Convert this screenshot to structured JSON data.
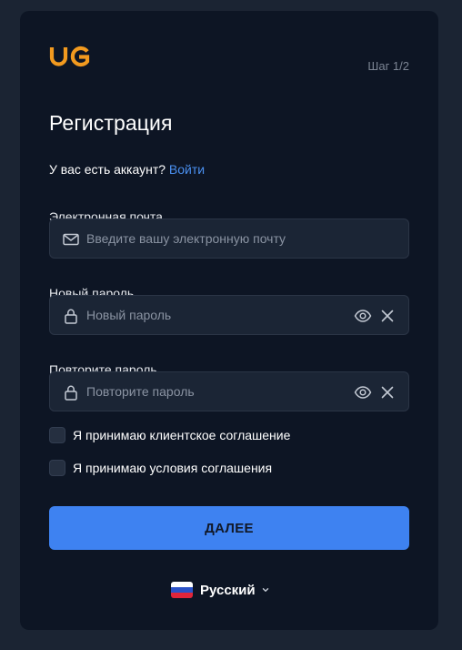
{
  "header": {
    "logo_text": "UG",
    "step": "Шаг 1/2"
  },
  "form": {
    "title": "Регистрация",
    "account_prompt": "У вас есть аккаунт?",
    "login_link": "Войти",
    "email": {
      "label": "Электронная почта",
      "placeholder": "Введите вашу электронную почту",
      "value": ""
    },
    "new_password": {
      "label": "Новый пароль",
      "placeholder": "Новый пароль",
      "value": ""
    },
    "repeat_password": {
      "label": "Повторите пароль",
      "placeholder": "Повторите пароль",
      "value": ""
    },
    "agreements": [
      {
        "label": "Я принимаю клиентское соглашение",
        "checked": false
      },
      {
        "label": "Я принимаю условия соглашения",
        "checked": false
      }
    ],
    "submit_label": "ДАЛЕЕ"
  },
  "language": {
    "selected": "Русский",
    "flag_icon": "russia-flag-icon"
  },
  "colors": {
    "page_bg": "#1b2433",
    "card_bg": "#0d1524",
    "field_bg": "#1b2535",
    "accent": "#3e82f1",
    "link": "#4a90f0",
    "logo_orange": "#f29a1f"
  }
}
